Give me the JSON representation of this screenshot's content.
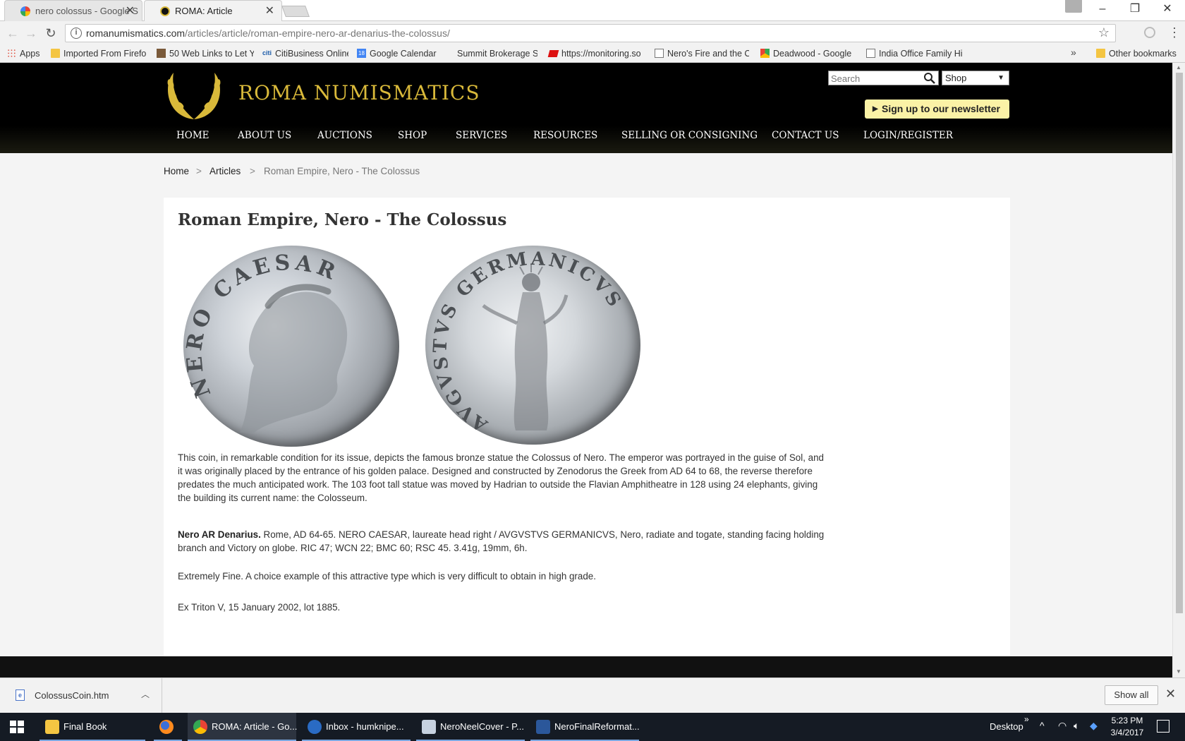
{
  "browser": {
    "tabs": [
      {
        "title": "nero colossus - Google S",
        "active": false
      },
      {
        "title": "ROMA: Article",
        "active": true
      }
    ],
    "url_host": "romanumismatics.com",
    "url_path": "/articles/article/roman-empire-nero-ar-denarius-the-colossus/",
    "bookmarks": [
      {
        "label": "Apps",
        "icon": "apps-grid-icon"
      },
      {
        "label": "Imported From Firefo",
        "icon": "folder-icon"
      },
      {
        "label": "50 Web Links to Let Y",
        "icon": "page-icon"
      },
      {
        "label": "CitiBusiness Online",
        "icon": "citi-icon"
      },
      {
        "label": "Google Calendar",
        "icon": "calendar-icon"
      },
      {
        "label": "Summit Brokerage Se",
        "icon": "page-icon"
      },
      {
        "label": "https://monitoring.so",
        "icon": "page-icon"
      },
      {
        "label": "Nero's Fire and the Cl",
        "icon": "page-icon"
      },
      {
        "label": "Deadwood - Google M",
        "icon": "maps-icon"
      },
      {
        "label": "India Office Family Hi",
        "icon": "page-icon"
      },
      {
        "label": "Other bookmarks",
        "icon": "folder-icon"
      }
    ],
    "more_bookmarks": "»"
  },
  "site": {
    "logo_text": "ROMA NUMISMATICS",
    "search_placeholder": "Search",
    "shop_select": "Shop",
    "newsletter": "Sign up to our newsletter",
    "nav": [
      "HOME",
      "ABOUT US",
      "AUCTIONS",
      "SHOP",
      "SERVICES",
      "RESOURCES",
      "SELLING OR CONSIGNING",
      "CONTACT US",
      "LOGIN/REGISTER"
    ]
  },
  "breadcrumb": {
    "items": [
      "Home",
      "Articles",
      "Roman Empire, Nero - The Colossus"
    ],
    "separator": ">"
  },
  "article": {
    "title": "Roman Empire, Nero - The Colossus",
    "coin_obverse_legend": "NERO CAESAR",
    "coin_reverse_legend": "AVGVSTVS GERMANICVS",
    "p1": "This coin, in remarkable condition for its issue, depicts the famous bronze statue the Colossus of Nero. The emperor was portrayed in the guise of Sol, and it was originally placed by the entrance of his golden palace. Designed and constructed by Zenodorus the Greek from AD 64 to 68, the reverse therefore predates the much anticipated work. The 103 foot tall statue was moved by Hadrian to outside the Flavian Amphitheatre in 128 using 24 elephants, giving the building its current name: the Colosseum.",
    "p2_bold": "Nero AR Denarius.",
    "p2_rest": " Rome, AD 64-65. NERO CAESAR, laureate head right / AVGVSTVS GERMANICVS, Nero, radiate and togate, standing facing holding branch and Victory on globe. RIC 47; WCN 22; BMC 60; RSC 45. 3.41g, 19mm, 6h.",
    "p3": "Extremely Fine. A choice example of this attractive type which is very difficult to obtain in high grade.",
    "p4": "Ex Triton V, 15 January 2002, lot 1885."
  },
  "downloads": {
    "file": "ColossusCoin.htm",
    "show_all": "Show all"
  },
  "taskbar": {
    "items": [
      "Final Book",
      "",
      "ROMA: Article - Go...",
      "Inbox - humknipe...",
      "NeroNeelCover - P...",
      "NeroFinalReformat..."
    ],
    "desktop": "Desktop",
    "time": "5:23 PM",
    "date": "3/4/2017"
  }
}
